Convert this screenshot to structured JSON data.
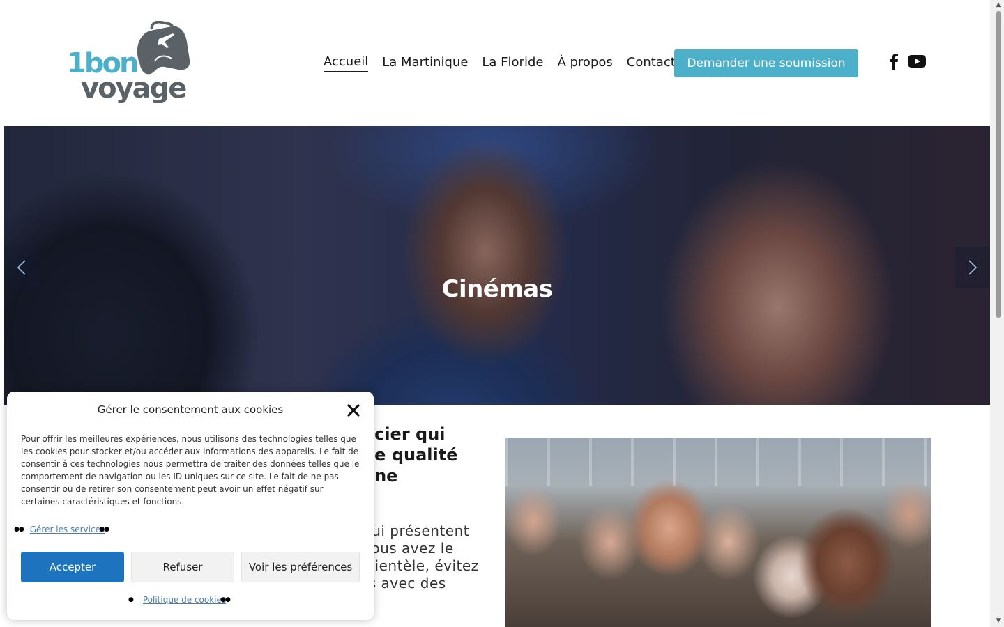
{
  "brand": {
    "logo_text_line1": "1bon",
    "logo_text_line2": "voyage",
    "logo_color": "#5a6268"
  },
  "nav": {
    "items": [
      "Accueil",
      "La Martinique",
      "La Floride",
      "À propos",
      "Contact"
    ],
    "active": "Accueil",
    "cta_label": "Demander une soumission",
    "cta_color": "#4db0cb",
    "social": [
      "facebook-icon",
      "youtube-icon"
    ]
  },
  "hero": {
    "title": "Cinémas",
    "prev_icon": "chevron-left-icon",
    "next_icon": "chevron-right-icon"
  },
  "content": {
    "heading_lines": [
      "ncier qui",
      "de qualité",
      "une"
    ],
    "paragraph_lines": [
      "qui présentent",
      "vous avez le",
      "clientèle, évitez",
      "rs avec des"
    ]
  },
  "cookie_modal": {
    "title": "Gérer le consentement aux cookies",
    "text": "Pour offrir les meilleures expériences, nous utilisons des technologies telles que les cookies pour stocker et/ou accéder aux informations des appareils. Le fait de consentir à ces technologies nous permettra de traiter des données telles que le comportement de navigation ou les ID uniques sur ce site. Le fait de ne pas consentir ou de retirer son consentement peut avoir un effet négatif sur certaines caractéristiques et fonctions.",
    "manage_services_label": "Gérer les services",
    "accept_label": "Accepter",
    "refuse_label": "Refuser",
    "preferences_label": "Voir les préférences",
    "policy_label": "Politique de cookies",
    "accept_color": "#1e73be"
  }
}
